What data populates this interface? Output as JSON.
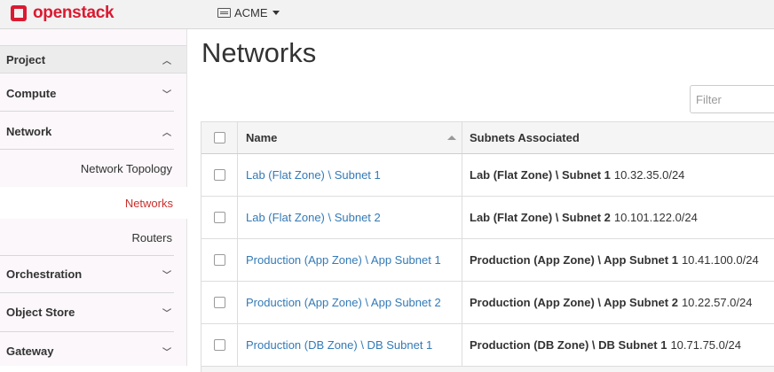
{
  "topbar": {
    "brand": "openstack",
    "project_selector": "ACME"
  },
  "sidebar": {
    "sections": {
      "project": "Project",
      "compute": "Compute",
      "network": "Network",
      "orchestration": "Orchestration",
      "object_store": "Object Store",
      "gateway": "Gateway"
    },
    "network_items": {
      "topology": "Network Topology",
      "networks": "Networks",
      "routers": "Routers"
    }
  },
  "main": {
    "title": "Networks",
    "filter_placeholder": "Filter",
    "table": {
      "columns": {
        "name": "Name",
        "subnets": "Subnets Associated"
      },
      "rows": [
        {
          "name": "Lab (Flat Zone) \\ Subnet 1",
          "subnet_name": "Lab (Flat Zone) \\ Subnet 1",
          "cidr": "10.32.35.0/24"
        },
        {
          "name": "Lab (Flat Zone) \\ Subnet 2",
          "subnet_name": "Lab (Flat Zone) \\ Subnet 2",
          "cidr": "10.101.122.0/24"
        },
        {
          "name": "Production (App Zone) \\ App Subnet 1",
          "subnet_name": "Production (App Zone) \\ App Subnet 1",
          "cidr": "10.41.100.0/24"
        },
        {
          "name": "Production (App Zone) \\ App Subnet 2",
          "subnet_name": "Production (App Zone) \\ App Subnet 2",
          "cidr": "10.22.57.0/24"
        },
        {
          "name": "Production (DB Zone) \\ DB Subnet 1",
          "subnet_name": "Production (DB Zone) \\ DB Subnet 1",
          "cidr": "10.71.75.0/24"
        }
      ]
    }
  },
  "icons": {
    "logo": "openstack-logo-icon",
    "project_selector": "server-icon",
    "dropdown": "caret-down-icon",
    "expand": "chevron-down-icon",
    "collapse": "chevron-up-icon",
    "sort": "sort-up-icon"
  },
  "colors": {
    "brand": "#da1a32",
    "link": "#337ab7",
    "active_nav": "#c9302c"
  }
}
